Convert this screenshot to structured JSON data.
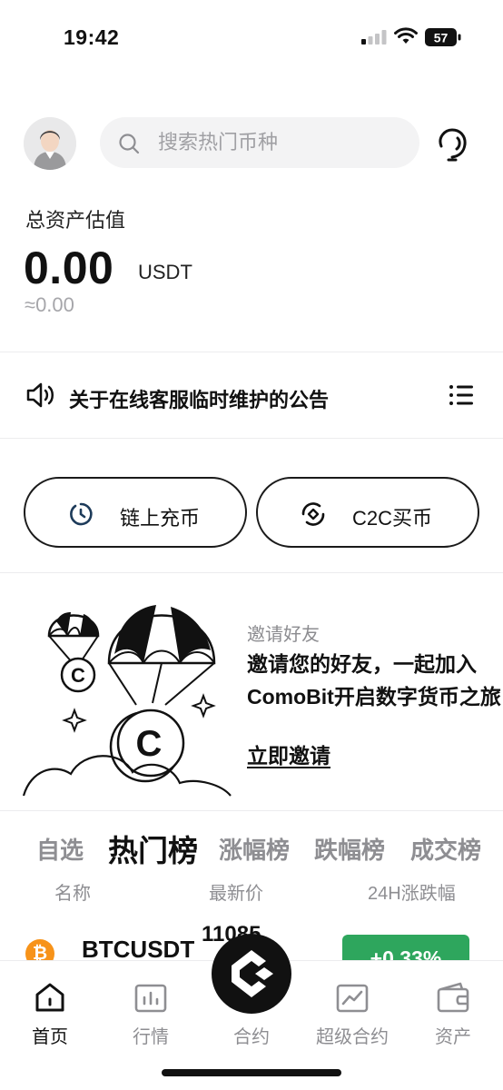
{
  "status_bar": {
    "time": "19:42",
    "battery": "57"
  },
  "header": {
    "search_placeholder": "搜索热门币种"
  },
  "assets": {
    "label": "总资产估值",
    "value": "0.00",
    "unit": "USDT",
    "approx": "≈0.00"
  },
  "notice": {
    "text": "关于在线客服临时维护的公告"
  },
  "actions": {
    "deposit_label": "链上充币",
    "c2c_label": "C2C买币"
  },
  "invite": {
    "kicker": "邀请好友",
    "line1": "邀请您的好友，一起加入",
    "line2": "ComoBit开启数字货币之旅",
    "link": "立即邀请"
  },
  "market": {
    "tabs": [
      "自选",
      "热门榜",
      "涨幅榜",
      "跌幅榜",
      "成交榜"
    ],
    "active_tab": "热门榜",
    "columns": [
      "名称",
      "最新价",
      "24H涨跌幅"
    ],
    "rows": [
      {
        "symbol": "BTCUSDT",
        "price": "11085",
        "change": "+0.33%",
        "coin_glyph": "₿"
      }
    ]
  },
  "tabbar": {
    "items": [
      "首页",
      "行情",
      "合约",
      "超级合约",
      "资产"
    ],
    "active": "首页"
  },
  "colors": {
    "up": "#2ea65d",
    "btc": "#f7931a",
    "text": "#111111",
    "muted": "#8e8e92"
  }
}
